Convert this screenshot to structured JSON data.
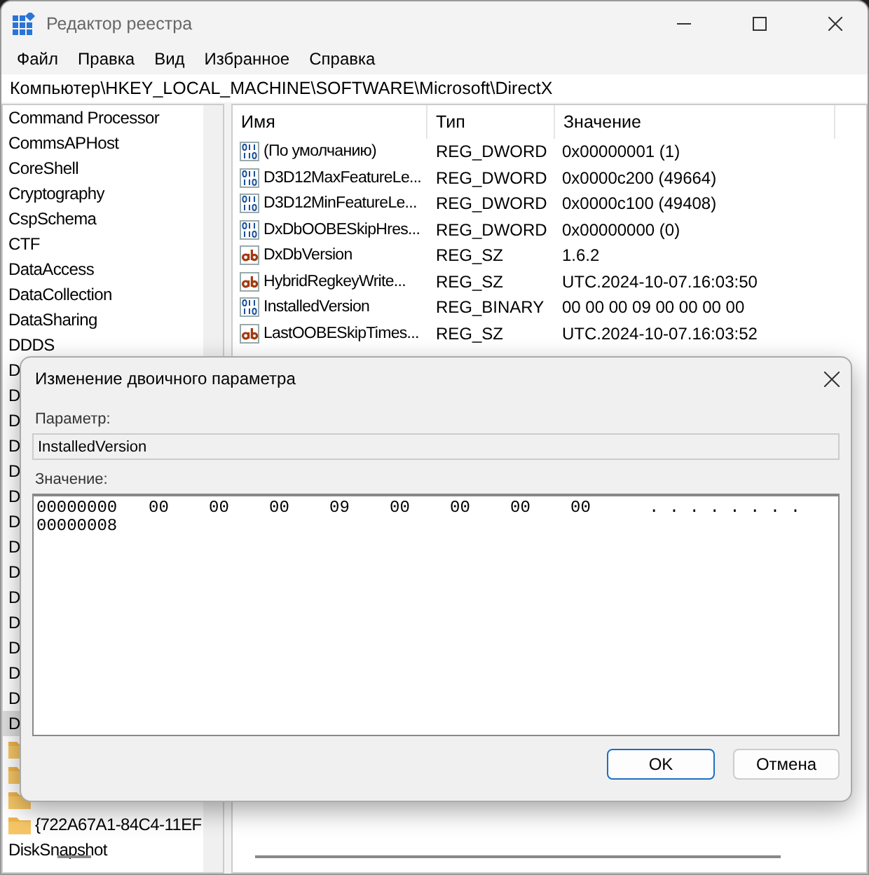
{
  "window": {
    "title": "Редактор реестра"
  },
  "menu": [
    "Файл",
    "Правка",
    "Вид",
    "Избранное",
    "Справка"
  ],
  "address": "Компьютер\\HKEY_LOCAL_MACHINE\\SOFTWARE\\Microsoft\\DirectX",
  "tree": [
    {
      "label": "Command Processor",
      "kind": "key",
      "selected": false
    },
    {
      "label": "CommsAPHost",
      "kind": "key",
      "selected": false
    },
    {
      "label": "CoreShell",
      "kind": "key",
      "selected": false
    },
    {
      "label": "Cryptography",
      "kind": "key",
      "selected": false
    },
    {
      "label": "CspSchema",
      "kind": "key",
      "selected": false
    },
    {
      "label": "CTF",
      "kind": "key",
      "selected": false
    },
    {
      "label": "DataAccess",
      "kind": "key",
      "selected": false
    },
    {
      "label": "DataCollection",
      "kind": "key",
      "selected": false
    },
    {
      "label": "DataSharing",
      "kind": "key",
      "selected": false
    },
    {
      "label": "DDDS",
      "kind": "key",
      "selected": false
    },
    {
      "label": "D",
      "kind": "key",
      "selected": false
    },
    {
      "label": "D",
      "kind": "key",
      "selected": false
    },
    {
      "label": "D",
      "kind": "key",
      "selected": false
    },
    {
      "label": "D",
      "kind": "key",
      "selected": false
    },
    {
      "label": "D",
      "kind": "key",
      "selected": false
    },
    {
      "label": "D",
      "kind": "key",
      "selected": false
    },
    {
      "label": "D",
      "kind": "key",
      "selected": false
    },
    {
      "label": "D",
      "kind": "key",
      "selected": false
    },
    {
      "label": "D",
      "kind": "key",
      "selected": false
    },
    {
      "label": "D",
      "kind": "key",
      "selected": false
    },
    {
      "label": "D",
      "kind": "key",
      "selected": false
    },
    {
      "label": "D",
      "kind": "key",
      "selected": false
    },
    {
      "label": "D",
      "kind": "key",
      "selected": false
    },
    {
      "label": "D",
      "kind": "key",
      "selected": false
    },
    {
      "label": "D",
      "kind": "key",
      "selected": true
    },
    {
      "kind": "folder",
      "selected": false
    },
    {
      "kind": "folder",
      "selected": false
    },
    {
      "kind": "folder",
      "selected": false
    },
    {
      "label": "{722A67A1-84C4-11EF",
      "kind": "folder",
      "selected": false
    },
    {
      "label": "DiskSnapshot",
      "kind": "key",
      "selected": false
    }
  ],
  "table": {
    "columns": [
      "Имя",
      "Тип",
      "Значение"
    ],
    "rows": [
      {
        "kind": "binary",
        "name": "(По умолчанию)",
        "type": "REG_DWORD",
        "value": "0x00000001 (1)"
      },
      {
        "kind": "binary",
        "name": "D3D12MaxFeatureLe...",
        "type": "REG_DWORD",
        "value": "0x0000c200 (49664)"
      },
      {
        "kind": "binary",
        "name": "D3D12MinFeatureLe...",
        "type": "REG_DWORD",
        "value": "0x0000c100 (49408)"
      },
      {
        "kind": "binary",
        "name": "DxDbOOBESkipHres...",
        "type": "REG_DWORD",
        "value": "0x00000000 (0)"
      },
      {
        "kind": "string",
        "name": "DxDbVersion",
        "type": "REG_SZ",
        "value": "1.6.2"
      },
      {
        "kind": "string",
        "name": "HybridRegkeyWrite...",
        "type": "REG_SZ",
        "value": "UTC.2024-10-07.16:03:50"
      },
      {
        "kind": "binary",
        "name": "InstalledVersion",
        "type": "REG_BINARY",
        "value": "00 00 00 09 00 00 00 00"
      },
      {
        "kind": "string",
        "name": "LastOOBESkipTimes...",
        "type": "REG_SZ",
        "value": "UTC.2024-10-07.16:03:52"
      }
    ]
  },
  "dialog": {
    "title": "Изменение двоичного параметра",
    "name_label": "Параметр:",
    "name_value": "InstalledVersion",
    "value_label": "Значение:",
    "hex_rows": [
      {
        "address": "00000000",
        "bytes": [
          "00",
          "00",
          "00",
          "09",
          "00",
          "00",
          "00",
          "00"
        ],
        "ascii": ". . . . . . . ."
      },
      {
        "address": "00000008"
      }
    ],
    "buttons": [
      {
        "label": "OK",
        "kind": "default"
      },
      {
        "label": "Отмена",
        "kind": "normal"
      }
    ]
  }
}
